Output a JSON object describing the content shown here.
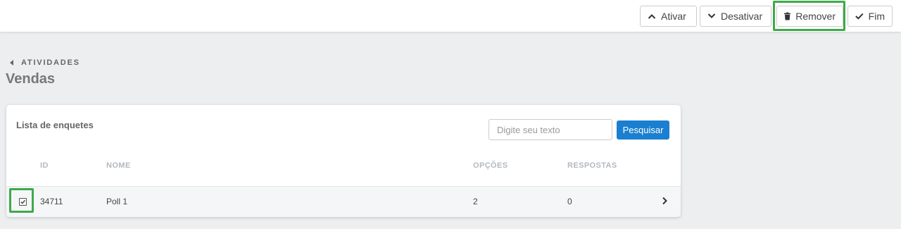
{
  "toolbar": {
    "activate_label": "Ativar",
    "deactivate_label": "Desativar",
    "remove_label": "Remover",
    "finish_label": "Fim"
  },
  "breadcrumb": {
    "label": "ATIVIDADES"
  },
  "page": {
    "title": "Vendas"
  },
  "card": {
    "title": "Lista de enquetes",
    "search_placeholder": "Digite seu texto",
    "search_button": "Pesquisar"
  },
  "table": {
    "columns": {
      "id": "ID",
      "name": "NOME",
      "options": "OPÇÕES",
      "responses": "RESPOSTAS"
    },
    "rows": [
      {
        "id": "34711",
        "name": "Poll 1",
        "options": "2",
        "responses": "0",
        "checked": true
      }
    ]
  },
  "colors": {
    "highlight": "#3eaa4a",
    "primary_button": "#1a7fd0"
  }
}
